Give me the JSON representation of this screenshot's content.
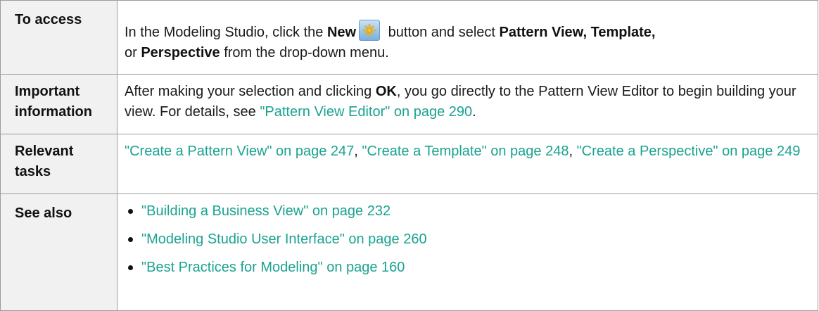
{
  "rows": {
    "access": {
      "label": "To access",
      "text_1": "In the Modeling Studio, click the ",
      "bold_new": "New",
      "icon": "new-star-icon",
      "text_2": " button and select ",
      "bold_pattern_view": "Pattern View,",
      "text_3": " ",
      "bold_template": "Template,",
      "text_4": "or ",
      "bold_perspective": "Perspective",
      "text_5": " from the drop-down menu."
    },
    "important": {
      "label": "Important information",
      "text_1": "After making your selection and clicking ",
      "bold_ok": "OK",
      "text_2": ", you go directly to the Pattern View Editor to begin building your view. For details, see ",
      "link": "\"Pattern View Editor\" on page 290",
      "text_3": "."
    },
    "tasks": {
      "label": "Relevant tasks",
      "links": [
        "\"Create a Pattern View\" on page 247",
        "\"Create a Template\" on page 248",
        "\"Create a Perspective\" on page 249"
      ],
      "separator": ", "
    },
    "see_also": {
      "label": "See also",
      "links": [
        "\"Building a Business View\" on page 232",
        "\"Modeling Studio User Interface\" on page 260",
        "\"Best Practices for Modeling\" on page 160"
      ]
    }
  },
  "colors": {
    "link": "#1aa38f",
    "label_background": "#f1f1f1",
    "border": "#9b9b9b",
    "icon_star": "#f2c22e"
  }
}
